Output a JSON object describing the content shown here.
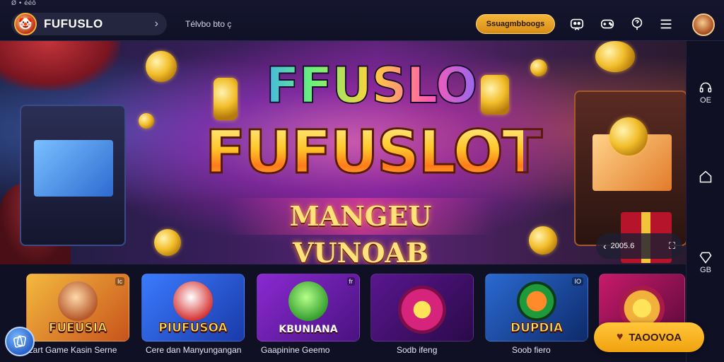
{
  "statusbar": {
    "text": "Ø • ééô"
  },
  "header": {
    "brand_name": "FUFUSLO",
    "tagline": "Télvbo bto ç",
    "promo_button": "Ssuagmbboogs",
    "icons": [
      "chat-bot-icon",
      "game-controller-icon",
      "support-icon",
      "menu-icon"
    ]
  },
  "hero": {
    "title_top": "FFUSLO",
    "title_main": "FUFUSLOT",
    "subtitle": "MANGEU VUNOAB",
    "carousel_label": "2005.6"
  },
  "siderail": {
    "items": [
      {
        "icon": "headset-icon",
        "label": "OE"
      },
      {
        "icon": "home-icon",
        "label": ""
      },
      {
        "icon": "diamond-icon",
        "label": "GB"
      }
    ]
  },
  "games": [
    {
      "title": "FUEUSIA",
      "badge": "Ic",
      "caption": "Lart Game Kasin Serne"
    },
    {
      "title": "PIUFUSOA",
      "badge": "",
      "caption": "Cere dan Manyungangan"
    },
    {
      "title": "KBUNIANA",
      "badge": "fr",
      "caption": "Gaapinine Geemo"
    },
    {
      "title": "",
      "badge": "",
      "caption": "Sodb ifeng"
    },
    {
      "title": "DUPDIA",
      "badge": "IO",
      "caption": "Soob fiero"
    },
    {
      "title": "",
      "badge": "",
      "caption": ""
    }
  ],
  "cta": {
    "label": "TAOOVOA"
  },
  "colors": {
    "accent": "#f2b13b",
    "background": "#0e0f22",
    "cta": "#ffc63a"
  }
}
